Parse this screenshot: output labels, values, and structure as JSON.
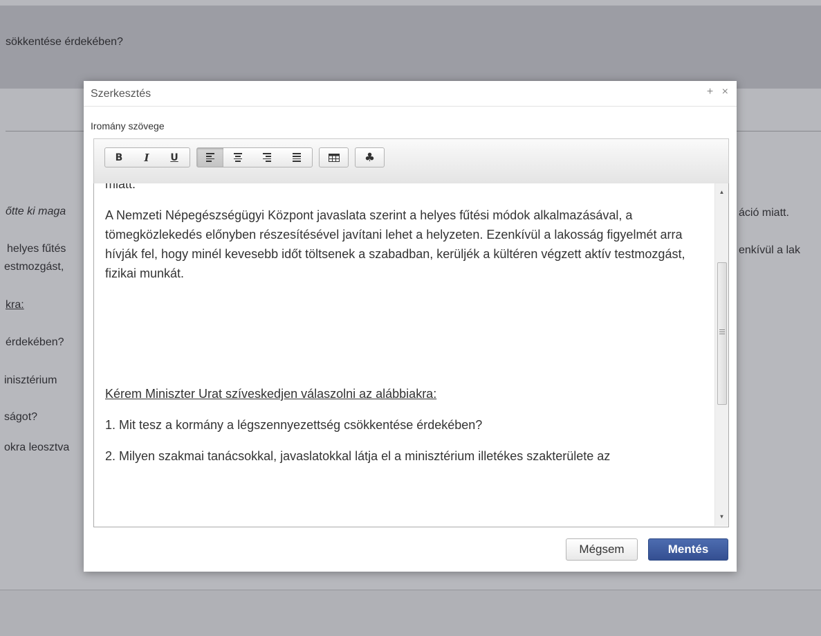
{
  "background": {
    "header_text": "sökkentése érdekében?",
    "left_fragments": [
      "őtte ki maga",
      "helyes fűtés",
      "estmozgást,",
      "kra:",
      "érdekében?",
      "inisztérium",
      "ságot?",
      "okra leosztva"
    ],
    "right_fragments": [
      "áció miatt.",
      "enkívül a lak"
    ]
  },
  "modal": {
    "title": "Szerkesztés",
    "controls": {
      "expand": "+",
      "close": "×"
    },
    "field_label": "Iromány szövege",
    "toolbar": {
      "bold": "B",
      "italic": "I",
      "underline": "U",
      "align_left_icon": "align-left-icon",
      "align_center_icon": "align-center-icon",
      "align_right_icon": "align-right-icon",
      "justify_icon": "justify-icon",
      "table_icon": "table-icon",
      "special_icon": "cloverleaf-icon",
      "special_glyph": "♣"
    },
    "content": {
      "cut_line": "miatt.",
      "paragraph_a": "A Nemzeti Népegészségügyi Központ javaslata szerint a helyes fűtési módok alkalmazásával, a tömegközlekedés előnyben részesítésével javítani lehet a helyzeten. Ezenkívül a lakosság figyelmét arra hívják fel, hogy minél kevesebb időt töltsenek a szabadban, kerüljék a kültéren végzett aktív testmozgást, fizikai munkát.",
      "request": "Kérem Miniszter Urat szíveskedjen válaszolni az alábbiakra:",
      "q1": "1. Mit tesz a kormány a légszennyezettség csökkentése érdekében?",
      "q2": "2. Milyen szakmai tanácsokkal, javaslatokkal látja el a minisztérium illetékes szakterülete az"
    },
    "buttons": {
      "cancel": "Mégsem",
      "save": "Mentés"
    },
    "colors": {
      "save_bg": "#3d5a9c",
      "overlay": "#8f9096"
    }
  }
}
